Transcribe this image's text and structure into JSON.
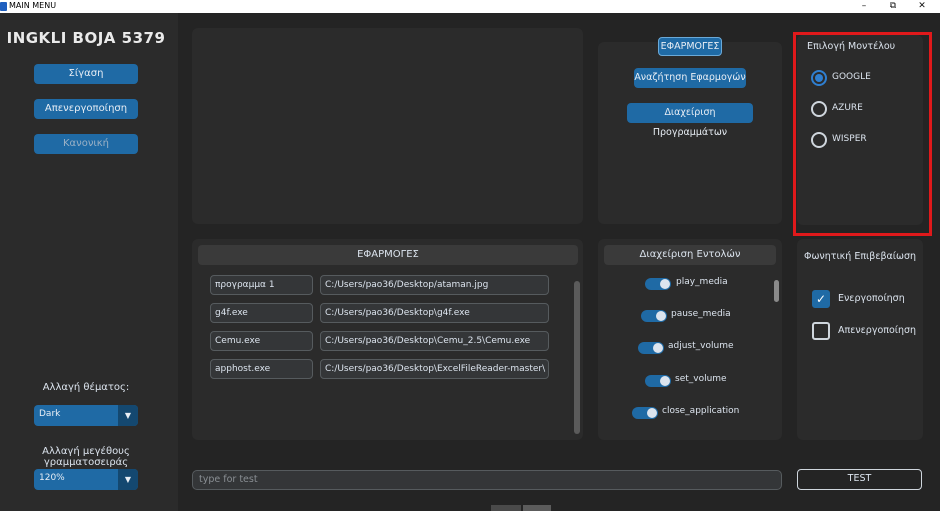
{
  "window": {
    "title": "MAIN MENU",
    "minimize": "–",
    "maximize": "⧉",
    "close": "✕"
  },
  "sidebar": {
    "user_name": "INGKLI BOJA 5379",
    "buttons": [
      {
        "label": "Σίγαση"
      },
      {
        "label": "Απενεργοποίηση"
      },
      {
        "label": "Κανονική"
      }
    ],
    "theme_label": "Αλλαγή θέματος:",
    "theme_value": "Dark",
    "font_size_label": "Αλλαγή μεγέθους γραμματοσειράς",
    "font_size_value": "120%"
  },
  "apps_panel": {
    "tab_label": "ΕΦΑΡΜΟΓΕΣ",
    "search_apps": "Αναζήτηση Εφαρμογών",
    "manage_programs": "Διαχείριση Προγραμμάτων"
  },
  "model": {
    "title": "Επιλογή Μοντέλου",
    "options": [
      {
        "label": "GOOGLE",
        "selected": true
      },
      {
        "label": "AZURE",
        "selected": false
      },
      {
        "label": "WISPER",
        "selected": false
      }
    ]
  },
  "apps_list": {
    "header": "ΕΦΑΡΜΟΓΕΣ",
    "rows": [
      {
        "name": "προγραμμα 1",
        "path": "C:/Users/pao36/Desktop/ataman.jpg"
      },
      {
        "name": "g4f.exe",
        "path": "C:/Users/pao36/Desktop\\g4f.exe"
      },
      {
        "name": "Cemu.exe",
        "path": "C:/Users/pao36/Desktop\\Cemu_2.5\\Cemu.exe"
      },
      {
        "name": "apphost.exe",
        "path": "C:/Users/pao36/Desktop\\ExcelFileReader-master\\"
      }
    ]
  },
  "commands": {
    "header": "Διαχείριση Εντολών",
    "items": [
      {
        "label": "play_media",
        "on": true
      },
      {
        "label": "pause_media",
        "on": true
      },
      {
        "label": "adjust_volume",
        "on": true
      },
      {
        "label": "set_volume",
        "on": true
      },
      {
        "label": "close_application",
        "on": true
      }
    ]
  },
  "voice_confirm": {
    "title": "Φωνητική Επιβεβαίωση",
    "enable": {
      "label": "Ενεργοποίηση",
      "checked": true
    },
    "disable": {
      "label": "Απενεργοποίηση",
      "checked": false
    }
  },
  "test": {
    "placeholder": "type for test",
    "button": "TEST"
  },
  "colors": {
    "accent": "#1f6aa5",
    "highlight": "#e0191b",
    "background": "#242424"
  }
}
